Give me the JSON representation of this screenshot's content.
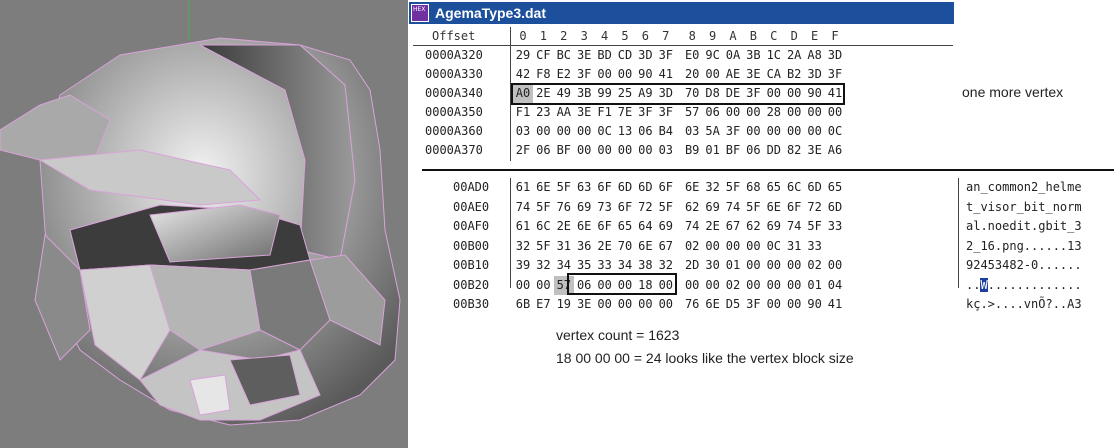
{
  "window": {
    "title": "AgemaType3.dat",
    "icon": "hex-editor-app-icon",
    "icon_text": "HEX"
  },
  "top_table": {
    "offset_header": "Offset",
    "col_headers": [
      "0",
      "1",
      "2",
      "3",
      "4",
      "5",
      "6",
      "7",
      "8",
      "9",
      "A",
      "B",
      "C",
      "D",
      "E",
      "F"
    ],
    "rows": [
      {
        "addr": "0000A320",
        "bytes": [
          "29",
          "CF",
          "BC",
          "3E",
          "BD",
          "CD",
          "3D",
          "3F",
          "E0",
          "9C",
          "0A",
          "3B",
          "1C",
          "2A",
          "A8",
          "3D"
        ]
      },
      {
        "addr": "0000A330",
        "bytes": [
          "42",
          "F8",
          "E2",
          "3F",
          "00",
          "00",
          "90",
          "41",
          "20",
          "00",
          "AE",
          "3E",
          "CA",
          "B2",
          "3D",
          "3F"
        ]
      },
      {
        "addr": "0000A340",
        "bytes": [
          "A0",
          "2E",
          "49",
          "3B",
          "99",
          "25",
          "A9",
          "3D",
          "70",
          "D8",
          "DE",
          "3F",
          "00",
          "00",
          "90",
          "41"
        ]
      },
      {
        "addr": "0000A350",
        "bytes": [
          "F1",
          "23",
          "AA",
          "3E",
          "F1",
          "7E",
          "3F",
          "3F",
          "57",
          "06",
          "00",
          "00",
          "28",
          "00",
          "00",
          "00"
        ]
      },
      {
        "addr": "0000A360",
        "bytes": [
          "03",
          "00",
          "00",
          "00",
          "0C",
          "13",
          "06",
          "B4",
          "03",
          "5A",
          "3F",
          "00",
          "00",
          "00",
          "00",
          "0C"
        ]
      },
      {
        "addr": "0000A370",
        "bytes": [
          "2F",
          "06",
          "BF",
          "00",
          "00",
          "00",
          "00",
          "03",
          "B9",
          "01",
          "BF",
          "06",
          "DD",
          "82",
          "3E",
          "A6"
        ]
      }
    ],
    "annotation": "one more vertex"
  },
  "bottom_table": {
    "rows": [
      {
        "addr": "00AD0",
        "bytes": [
          "61",
          "6E",
          "5F",
          "63",
          "6F",
          "6D",
          "6D",
          "6F",
          "6E",
          "32",
          "5F",
          "68",
          "65",
          "6C",
          "6D",
          "65"
        ],
        "ascii": "an_common2_helme"
      },
      {
        "addr": "00AE0",
        "bytes": [
          "74",
          "5F",
          "76",
          "69",
          "73",
          "6F",
          "72",
          "5F",
          "62",
          "69",
          "74",
          "5F",
          "6E",
          "6F",
          "72",
          "6D"
        ],
        "ascii": "t_visor_bit_norm"
      },
      {
        "addr": "00AF0",
        "bytes": [
          "61",
          "6C",
          "2E",
          "6E",
          "6F",
          "65",
          "64",
          "69",
          "74",
          "2E",
          "67",
          "62",
          "69",
          "74",
          "5F",
          "33"
        ],
        "ascii": "al.noedit.gbit_3"
      },
      {
        "addr": "00B00",
        "bytes": [
          "32",
          "5F",
          "31",
          "36",
          "2E",
          "70",
          "6E",
          "67",
          "02",
          "00",
          "00",
          "00",
          "0C",
          "31",
          "33"
        ],
        "ascii": "2_16.png......13"
      },
      {
        "addr": "00B10",
        "bytes": [
          "39",
          "32",
          "34",
          "35",
          "33",
          "34",
          "38",
          "32",
          "2D",
          "30",
          "01",
          "00",
          "00",
          "00",
          "02",
          "00"
        ],
        "ascii": "92453482-0......"
      },
      {
        "addr": "00B20",
        "bytes": [
          "00",
          "00",
          "57",
          "06",
          "00",
          "00",
          "18",
          "00",
          "00",
          "00",
          "02",
          "00",
          "00",
          "00",
          "01",
          "04"
        ],
        "ascii_pre": "..",
        "ascii_cur": "W",
        "ascii_post": "............."
      },
      {
        "addr": "00B30",
        "bytes": [
          "6B",
          "E7",
          "19",
          "3E",
          "00",
          "00",
          "00",
          "00",
          "76",
          "6E",
          "D5",
          "3F",
          "00",
          "00",
          "90",
          "41"
        ],
        "ascii": "kç.>....vnÕ?..A3"
      }
    ]
  },
  "notes": {
    "vertex_count": "vertex count = 1623",
    "block_size": "18 00 00 00 = 24 looks like the vertex block size"
  },
  "colors": {
    "titlebar": "#1c4f9c",
    "viewport_bg": "#7d7d7d",
    "cursor_highlight": "#1c3f9c"
  }
}
